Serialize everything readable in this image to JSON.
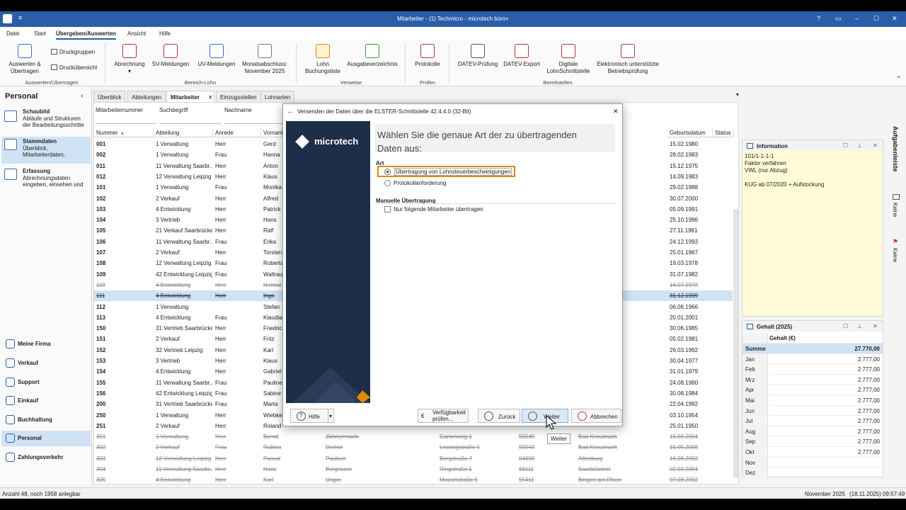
{
  "window": {
    "title": "Mitarbeiter - (1) Techmicro - microtech büro+",
    "help_glyph": "?",
    "minimize_glyph": "–",
    "maximize_glyph": "☐",
    "close_glyph": "✕"
  },
  "menu": [
    "Datei",
    "Start",
    "Übergeben/Auswerten",
    "Ansicht",
    "Hilfe"
  ],
  "menu_active": "Übergeben/Auswerten",
  "ribbon": {
    "auswerten": "Auswerten & Übertragen",
    "druckgruppen": "Druckgruppen",
    "druckuebersicht": "Druckübersicht",
    "group_auswerten": "Auswerten/Übertragen",
    "abrechnung": "Abrechnung",
    "sv_meldungen": "SV-Meldungen",
    "uv_meldungen": "UV-Meldungen",
    "monatsabschluss_1": "Monatsabschluss:",
    "monatsabschluss_2": "November 2025",
    "group_bereich_lohn": "Bereich-Lohn",
    "lohn_buchungsliste_1": "Lohn",
    "lohn_buchungsliste_2": "Buchungsliste",
    "ausgabeverzeichnis": "Ausgabeverzeichnis",
    "group_verweise": "Verweise",
    "protokolle": "Protokolle",
    "group_pruefen": "Prüfen",
    "datev_pruefung": "DATEV-Prüfung",
    "datev_export": "DATEV-Export",
    "digitale_1": "Digitale",
    "digitale_2": "LohnSchnittstelle",
    "elektronisch_1": "Elektronisch unterstützte",
    "elektronisch_2": "Betriebsprüfung",
    "group_bereitstellen": "Bereitstellen",
    "collapse_glyph": "⌃"
  },
  "left": {
    "title": "Personal",
    "collapse": "‹",
    "nav": [
      {
        "title": "Schaubild",
        "sub1": "Abläufe und Strukturen",
        "sub2": "der Bearbeitungsschritte"
      },
      {
        "title": "Stammdaten",
        "sub1": "Überblick,",
        "sub2": "Mitarbeiterdaten,"
      },
      {
        "title": "Erfassung",
        "sub1": "Abrechnungsdaten",
        "sub2": "eingeben, einsehen und"
      }
    ],
    "modules": [
      "Meine Firma",
      "Verkauf",
      "Support",
      "Einkauf",
      "Buchhaltung",
      "Personal",
      "Zahlungsverkehr"
    ]
  },
  "tabs": [
    "Überblick",
    "Abteilungen",
    "Mitarbeiter",
    "Einzugsstellen",
    "Lohnarten"
  ],
  "tab_close": "✕",
  "filters": {
    "mitarbeiternummer": "Mitarbeiternummer",
    "suchbegriff": "Suchbegriff",
    "nachname": "Nachname"
  },
  "columns": {
    "nummer": "Nummer",
    "abteilung": "Abteilung",
    "anrede": "Anrede",
    "vorname": "Vornam",
    "geburtsdatum": "Geburtsdatum",
    "status": "Status"
  },
  "rows": [
    {
      "nr": "001",
      "abt": "1 Verwaltung",
      "anr": "Herr",
      "vn": "Gerd",
      "nn": "",
      "str": "",
      "plz": "",
      "ort": "",
      "geb": "15.02.1980",
      "inactive": false
    },
    {
      "nr": "002",
      "abt": "1 Verwaltung",
      "anr": "Frau",
      "vn": "Hanna",
      "nn": "",
      "str": "",
      "plz": "",
      "ort": "",
      "geb": "28.02.1983",
      "inactive": false
    },
    {
      "nr": "011",
      "abt": "11 Verwaltung Saarbr...",
      "anr": "Herr",
      "vn": "Anton",
      "nn": "",
      "str": "",
      "plz": "",
      "ort": "",
      "geb": "15.12.1975",
      "inactive": false
    },
    {
      "nr": "012",
      "abt": "12 Verwaltung Leipzig",
      "anr": "Herr",
      "vn": "Klaus",
      "nn": "",
      "str": "",
      "plz": "",
      "ort": "",
      "geb": "14.09.1983",
      "inactive": false
    },
    {
      "nr": "101",
      "abt": "1 Verwaltung",
      "anr": "Frau",
      "vn": "Monika",
      "nn": "",
      "str": "",
      "plz": "",
      "ort": "",
      "geb": "29.02.1988",
      "inactive": false
    },
    {
      "nr": "102",
      "abt": "2 Verkauf",
      "anr": "Herr",
      "vn": "Alfred",
      "nn": "",
      "str": "",
      "plz": "",
      "ort": "",
      "geb": "30.07.2000",
      "inactive": false
    },
    {
      "nr": "103",
      "abt": "4 Entwicklung",
      "anr": "Herr",
      "vn": "Patrick",
      "nn": "",
      "str": "",
      "plz": "",
      "ort": "",
      "geb": "05.09.1991",
      "inactive": false
    },
    {
      "nr": "104",
      "abt": "3 Vertrieb",
      "anr": "Herr",
      "vn": "Hans",
      "nn": "",
      "str": "",
      "plz": "",
      "ort": "",
      "geb": "25.10.1996",
      "inactive": false
    },
    {
      "nr": "105",
      "abt": "21 Verkauf Saarbrücken",
      "anr": "Herr",
      "vn": "Ralf",
      "nn": "",
      "str": "",
      "plz": "",
      "ort": "",
      "geb": "27.11.1981",
      "inactive": false
    },
    {
      "nr": "106",
      "abt": "11 Verwaltung Saarbr...",
      "anr": "Frau",
      "vn": "Erika",
      "nn": "",
      "str": "",
      "plz": "",
      "ort": "",
      "geb": "24.12.1993",
      "inactive": false
    },
    {
      "nr": "107",
      "abt": "2 Verkauf",
      "anr": "Herr",
      "vn": "Torsten",
      "nn": "",
      "str": "",
      "plz": "",
      "ort": "",
      "geb": "25.01.1967",
      "inactive": false
    },
    {
      "nr": "108",
      "abt": "12 Verwaltung Leipzig",
      "anr": "Frau",
      "vn": "Roberta",
      "nn": "",
      "str": "",
      "plz": "",
      "ort": "",
      "geb": "19.03.1978",
      "inactive": false
    },
    {
      "nr": "109",
      "abt": "42 Entwicklung Leipzig",
      "anr": "Frau",
      "vn": "Waltrau",
      "nn": "",
      "str": "",
      "plz": "",
      "ort": "",
      "geb": "31.07.1982",
      "inactive": false
    },
    {
      "nr": "110",
      "abt": "4 Entwicklung",
      "anr": "Herr",
      "vn": "Helmut",
      "nn": "",
      "str": "",
      "plz": "",
      "ort": "",
      "geb": "14.07.1972",
      "inactive": true
    },
    {
      "nr": "111",
      "abt": "4 Entwicklung",
      "anr": "Herr",
      "vn": "Ingo",
      "nn": "",
      "str": "",
      "plz": "",
      "ort": "",
      "geb": "31.12.1999",
      "inactive": true,
      "sel": true
    },
    {
      "nr": "112",
      "abt": "1 Verwaltung",
      "anr": "",
      "vn": "Stefan",
      "nn": "",
      "str": "",
      "plz": "",
      "ort": "",
      "geb": "06.06.1966",
      "inactive": false
    },
    {
      "nr": "113",
      "abt": "4 Entwicklung",
      "anr": "Frau",
      "vn": "Klaudia",
      "nn": "",
      "str": "",
      "plz": "",
      "ort": "",
      "geb": "20.01.2001",
      "inactive": false
    },
    {
      "nr": "150",
      "abt": "31 Vertrieb Saarbrücken",
      "anr": "Herr",
      "vn": "Friedrich",
      "nn": "",
      "str": "",
      "plz": "",
      "ort": "",
      "geb": "30.06.1985",
      "inactive": false
    },
    {
      "nr": "151",
      "abt": "2 Verkauf",
      "anr": "Herr",
      "vn": "Fritz",
      "nn": "",
      "str": "",
      "plz": "",
      "ort": "",
      "geb": "05.02.1981",
      "inactive": false
    },
    {
      "nr": "152",
      "abt": "32 Vertrieb Leipzig",
      "anr": "Herr",
      "vn": "Karl",
      "nn": "",
      "str": "",
      "plz": "",
      "ort": "",
      "geb": "26.03.1992",
      "inactive": false
    },
    {
      "nr": "153",
      "abt": "3 Vertrieb",
      "anr": "Herr",
      "vn": "Klaus",
      "nn": "",
      "str": "",
      "plz": "",
      "ort": "",
      "geb": "30.04.1977",
      "inactive": false
    },
    {
      "nr": "154",
      "abt": "4 Entwicklung",
      "anr": "Herr",
      "vn": "Gabriel",
      "nn": "",
      "str": "",
      "plz": "",
      "ort": "",
      "geb": "31.01.1979",
      "inactive": false
    },
    {
      "nr": "155",
      "abt": "11 Verwaltung Saarbr...",
      "anr": "Frau",
      "vn": "Pauline",
      "nn": "",
      "str": "",
      "plz": "",
      "ort": "",
      "geb": "24.08.1980",
      "inactive": false
    },
    {
      "nr": "156",
      "abt": "42 Entwicklung Leipzig",
      "anr": "Frau",
      "vn": "Sabine",
      "nn": "",
      "str": "",
      "plz": "",
      "ort": "",
      "geb": "30.08.1984",
      "inactive": false
    },
    {
      "nr": "200",
      "abt": "31 Vertrieb Saarbrücken",
      "anr": "Frau",
      "vn": "Marta",
      "nn": "",
      "str": "",
      "plz": "",
      "ort": "",
      "geb": "22.04.1992",
      "inactive": false
    },
    {
      "nr": "250",
      "abt": "1 Verwaltung",
      "anr": "Herr",
      "vn": "Wiebke",
      "nn": "",
      "str": "",
      "plz": "",
      "ort": "",
      "geb": "03.10.1954",
      "inactive": false
    },
    {
      "nr": "251",
      "abt": "2 Verkauf",
      "anr": "Herr",
      "vn": "Roland",
      "nn": "",
      "str": "",
      "plz": "",
      "ort": "",
      "geb": "25.01.1950",
      "inactive": false
    },
    {
      "nr": "301",
      "abt": "1 Verwaltung",
      "anr": "Herr",
      "vn": "Bernd",
      "nn": "Zimmermann",
      "str": "Gartenweg 1",
      "plz": "55545",
      "ort": "Bad Kreuznach",
      "geb": "15.03.2004",
      "inactive": true
    },
    {
      "nr": "302",
      "abt": "2 Verkauf",
      "anr": "Frau",
      "vn": "Rubina",
      "nn": "Dreher",
      "str": "Lessingstraße 1",
      "plz": "55543",
      "ort": "Bad Kreuznach",
      "geb": "15.05.2006",
      "inactive": true
    },
    {
      "nr": "303",
      "abt": "12 Verwaltung Leipzig",
      "anr": "Herr",
      "vn": "Pascal",
      "nn": "Paulsen",
      "str": "Bergstraße 7",
      "plz": "04600",
      "ort": "Altenburg",
      "geb": "16.08.2002",
      "inactive": true
    },
    {
      "nr": "304",
      "abt": "11 Verwaltung Saarbr...",
      "anr": "Herr",
      "vn": "Hanc",
      "nn": "Bergmann",
      "str": "Ringstraße 1",
      "plz": "66111",
      "ort": "Saarbrücken",
      "geb": "02.03.2004",
      "inactive": true
    },
    {
      "nr": "305",
      "abt": "4 Entwicklung",
      "anr": "Herr",
      "vn": "Karl",
      "nn": "Unger",
      "str": "Mozartstraße 5",
      "plz": "55411",
      "ort": "Bingen am Rhein",
      "geb": "07.08.2002",
      "inactive": true
    }
  ],
  "info_panel": {
    "title": "Information",
    "lines": [
      "101/1-1-1-1",
      "Faktor verfahren",
      "VWL (nur Abzug)",
      "",
      "KUG ab 07/2020 + Aufstockung"
    ]
  },
  "gehalt_panel": {
    "title": "Gehalt (2025)",
    "col_header": "Gehalt (€)",
    "summe_label": "Summe",
    "summe_value": "27.770,00",
    "months": [
      {
        "m": "Jan",
        "v": "2.777,00"
      },
      {
        "m": "Feb",
        "v": "2.777,00"
      },
      {
        "m": "Mrz",
        "v": "2.777,00"
      },
      {
        "m": "Apr",
        "v": "2.777,00"
      },
      {
        "m": "Mai",
        "v": "2.777,00"
      },
      {
        "m": "Jun",
        "v": "2.777,00"
      },
      {
        "m": "Jul",
        "v": "2.777,00"
      },
      {
        "m": "Aug",
        "v": "2.777,00"
      },
      {
        "m": "Sep",
        "v": "2.777,00"
      },
      {
        "m": "Okt",
        "v": "2.777,00"
      },
      {
        "m": "Nov",
        "v": ""
      },
      {
        "m": "Dez",
        "v": ""
      }
    ]
  },
  "panel_buttons": {
    "float": "☐",
    "pin": "⊥",
    "close": "✕"
  },
  "vertical_tabs": [
    "Aufgabenleiste",
    "Keine",
    "Keine"
  ],
  "status": {
    "left": "Anzahl 48, noch 1958 anlegbar",
    "period": "November 2025",
    "date": "(18.11.2025)",
    "time": "09:57:49"
  },
  "dialog": {
    "title": "Versenden der Daten über die ELSTER-Schnittstelle 42.4.4.0 (32-Bit)",
    "close": "✕",
    "back_arrow": "←",
    "brand": "microtech",
    "heading_1": "Wählen Sie die genaue Art der zu übertragenden",
    "heading_2": "Daten aus:",
    "section_art": "Art",
    "option_1": "Übertragung von Lohnsteuerbescheinigungen",
    "option_2": "Protokollanforderung",
    "section_manual": "Manuelle Übertragung",
    "checkbox_label": "Nur folgende Mitarbeiter übertragen",
    "btn_help": "Hilfe",
    "btn_verfuegbarkeit_1": "Verfügbarkeit",
    "btn_verfuegbarkeit_2": "prüfen...",
    "btn_back": "Zurück",
    "btn_next": "Weiter",
    "btn_cancel": "Abbrechen",
    "tooltip": "Weiter",
    "help_q": "?",
    "dropdown_arrow": "▾",
    "selected_option": 1
  },
  "colors": {
    "titlebar": "#2a5ea8",
    "accent": "#2a5ea8",
    "selection": "#cfe3f5",
    "highlight": "#e08a00",
    "sidebar_dark": "#1f2e48"
  }
}
